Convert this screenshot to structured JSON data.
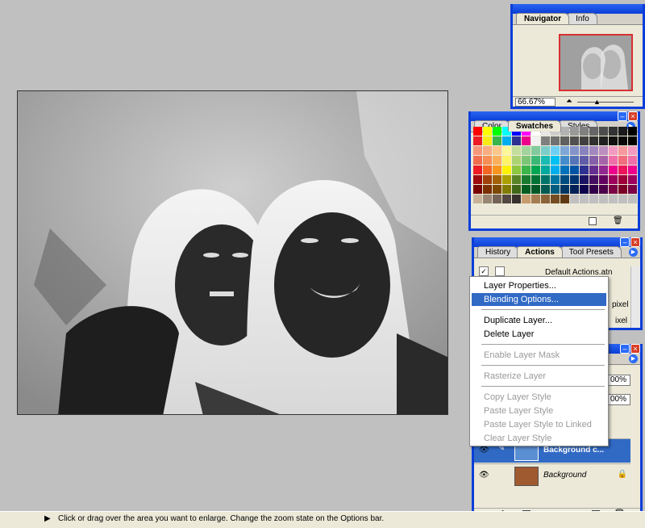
{
  "navigator": {
    "tabs": [
      "Navigator",
      "Info"
    ],
    "zoom": "66.67%"
  },
  "swatches": {
    "tabs": [
      "Color",
      "Swatches",
      "Styles"
    ],
    "colors": [
      "#ff0000",
      "#ffff00",
      "#00ff00",
      "#00ffff",
      "#0000ff",
      "#ff00ff",
      "#ffffff",
      "#e6e6e6",
      "#cccccc",
      "#b3b3b3",
      "#999999",
      "#808080",
      "#666666",
      "#4d4d4d",
      "#333333",
      "#1a1a1a",
      "#000000",
      "#ed1c24",
      "#f7ec13",
      "#3ab54a",
      "#00aeef",
      "#2e3192",
      "#ec008c",
      "#f2f2f2",
      "#7f7f7f",
      "#707070",
      "#606060",
      "#505050",
      "#404040",
      "#303030",
      "#202020",
      "#101010",
      "#080808",
      "#000000",
      "#f7977a",
      "#f9ad81",
      "#fdc68a",
      "#fff79a",
      "#c4df9b",
      "#a2d39c",
      "#82ca9d",
      "#7bcdc8",
      "#6ecff6",
      "#7ea7d8",
      "#8493ca",
      "#8882be",
      "#a187be",
      "#bc8dbf",
      "#f49ac2",
      "#f6989d",
      "#f49ac2",
      "#f26c4f",
      "#f68e55",
      "#fbaf5c",
      "#fff467",
      "#acd372",
      "#7cc576",
      "#3bb878",
      "#1abbb4",
      "#00bff3",
      "#438ccb",
      "#5574b9",
      "#605ca8",
      "#855fa8",
      "#a763a8",
      "#f06ea9",
      "#f26d7d",
      "#f06ea9",
      "#ed1c24",
      "#f26522",
      "#f7941d",
      "#fff200",
      "#8dc63f",
      "#39b54a",
      "#00a651",
      "#00a99d",
      "#00aeef",
      "#0072bc",
      "#0054a6",
      "#2e3192",
      "#662d91",
      "#92278f",
      "#ec008c",
      "#ed145b",
      "#ec008c",
      "#9e0b0f",
      "#a0410d",
      "#a36209",
      "#aba000",
      "#598527",
      "#1a7b30",
      "#007236",
      "#00746b",
      "#0076a3",
      "#004b80",
      "#003471",
      "#1b1464",
      "#440e62",
      "#630460",
      "#9e005d",
      "#9e0039",
      "#9e005d",
      "#790000",
      "#7b2e00",
      "#7d4900",
      "#827b00",
      "#406618",
      "#005e20",
      "#005826",
      "#005952",
      "#005b7f",
      "#003663",
      "#002157",
      "#0d004c",
      "#32004b",
      "#4b0049",
      "#7b0046",
      "#7a0026",
      "#7b0046",
      "#c7b299",
      "#998675",
      "#736357",
      "#534741",
      "#37302d",
      "#c69c6d",
      "#a67c52",
      "#8c6239",
      "#754c24",
      "#603913",
      "#c0c0c0",
      "#c0c0c0",
      "#c0c0c0",
      "#c0c0c0",
      "#c0c0c0",
      "#c0c0c0",
      "#c0c0c0"
    ]
  },
  "actions": {
    "tabs": [
      "History",
      "Actions",
      "Tool Presets"
    ],
    "set_name": "Default Actions.atn",
    "partial_right": [
      "pixel",
      "ixel"
    ]
  },
  "layers": {
    "percent": [
      "00%",
      "00%"
    ],
    "rows": [
      {
        "name": "Background c...",
        "selected": true
      },
      {
        "name": "Background",
        "selected": false
      }
    ]
  },
  "context_menu": {
    "items": [
      {
        "label": "Layer Properties...",
        "state": "normal"
      },
      {
        "label": "Blending Options...",
        "state": "highlight"
      },
      {
        "label": "Duplicate Layer...",
        "state": "normal"
      },
      {
        "label": "Delete Layer",
        "state": "normal"
      },
      {
        "label": "Enable Layer Mask",
        "state": "disabled"
      },
      {
        "label": "Rasterize Layer",
        "state": "disabled"
      },
      {
        "label": "Copy Layer Style",
        "state": "disabled"
      },
      {
        "label": "Paste Layer Style",
        "state": "disabled"
      },
      {
        "label": "Paste Layer Style to Linked",
        "state": "disabled"
      },
      {
        "label": "Clear Layer Style",
        "state": "disabled"
      }
    ]
  },
  "status_bar": {
    "text": "Click or drag over the area you want to enlarge. Change the zoom state on the Options bar."
  },
  "colors": {
    "title_blue": "#0a3ed8",
    "highlight": "#316ac5",
    "close_red": "#d84028"
  }
}
